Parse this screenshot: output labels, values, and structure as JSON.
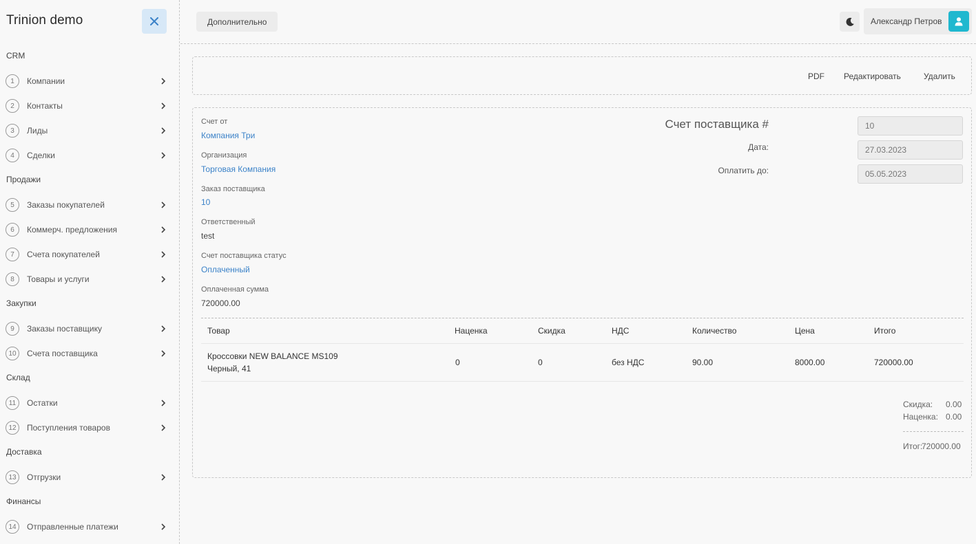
{
  "app": {
    "title": "Trinion demo"
  },
  "sidebar": {
    "sections": [
      {
        "title": "CRM"
      },
      {
        "title": "Продажи"
      },
      {
        "title": "Закупки"
      },
      {
        "title": "Склад"
      },
      {
        "title": "Доставка"
      },
      {
        "title": "Финансы"
      }
    ],
    "items": [
      {
        "num": "1",
        "label": "Компании"
      },
      {
        "num": "2",
        "label": "Контакты"
      },
      {
        "num": "3",
        "label": "Лиды"
      },
      {
        "num": "4",
        "label": "Сделки"
      },
      {
        "num": "5",
        "label": "Заказы покупателей"
      },
      {
        "num": "6",
        "label": "Коммерч. предложения"
      },
      {
        "num": "7",
        "label": "Счета покупателей"
      },
      {
        "num": "8",
        "label": "Товары и услуги"
      },
      {
        "num": "9",
        "label": "Заказы поставщику"
      },
      {
        "num": "10",
        "label": "Счета поставщика"
      },
      {
        "num": "11",
        "label": "Остатки"
      },
      {
        "num": "12",
        "label": "Поступления товаров"
      },
      {
        "num": "13",
        "label": "Отгрузки"
      },
      {
        "num": "14",
        "label": "Отправленные платежи"
      }
    ]
  },
  "topbar": {
    "extra_button": "Дополнительно",
    "user_name": "Александр Петров",
    "accent_color": "#20b8cf"
  },
  "actions": {
    "pdf": "PDF",
    "edit": "Редактировать",
    "delete": "Удалить"
  },
  "invoice": {
    "fields": [
      {
        "label": "Счет от",
        "value": "Компания Три"
      },
      {
        "label": "Организация",
        "value": "Торговая Компания"
      },
      {
        "label": "Заказ поставщика",
        "value": "10"
      },
      {
        "label": "Ответственный",
        "value": "test"
      },
      {
        "label": "Счет поставщика статус",
        "value": "Оплаченный"
      },
      {
        "label": "Оплаченная сумма",
        "value": "720000.00"
      }
    ],
    "title": "Счет поставщика #",
    "number": "10",
    "date_label": "Дата:",
    "date": "27.03.2023",
    "due_label": "Оплатить до:",
    "due": "05.05.2023"
  },
  "table": {
    "headers": [
      "Товар",
      "Наценка",
      "Скидка",
      "НДС",
      "Количество",
      "Цена",
      "Итого"
    ],
    "rows": [
      {
        "product_line1": "Кроссовки NEW BALANCE MS109",
        "product_line2": "Черный, 41",
        "markup": "0",
        "discount": "0",
        "vat": "без НДС",
        "qty": "90.00",
        "price": "8000.00",
        "total": "720000.00"
      }
    ]
  },
  "summary": {
    "discount_label": "Скидка:",
    "discount": "0.00",
    "markup_label": "Наценка:",
    "markup": "0.00",
    "total_label": "Итог:",
    "total": "720000.00"
  }
}
